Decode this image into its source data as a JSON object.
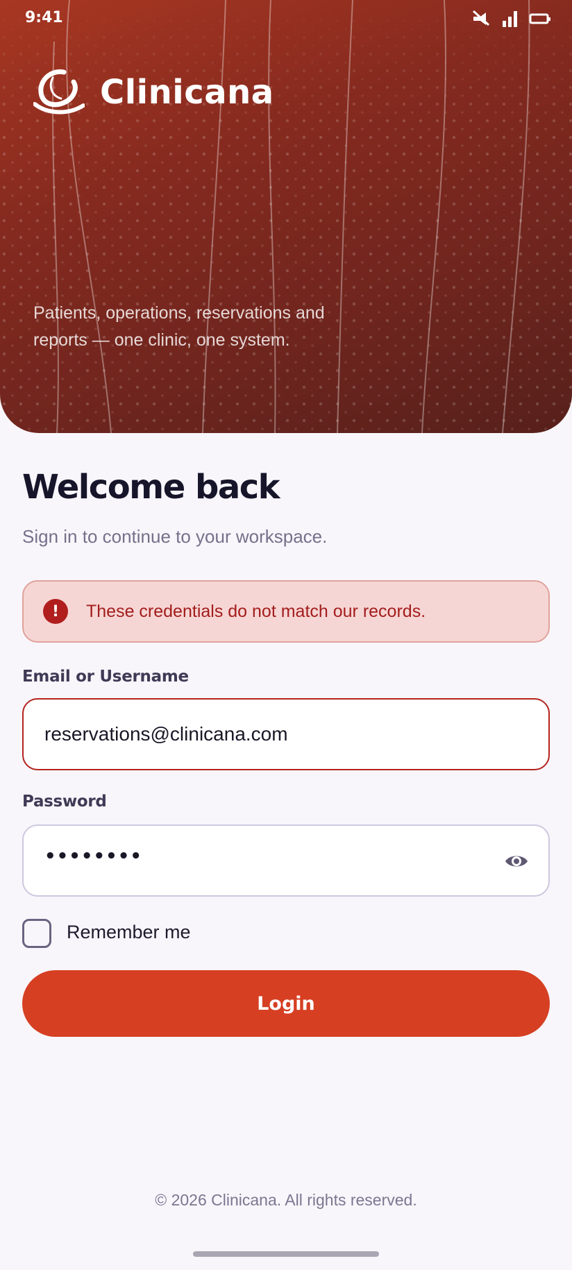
{
  "status_bar": {
    "time": "9:41",
    "icons": [
      "mute-icon",
      "signal-icon",
      "battery-icon"
    ]
  },
  "brand": {
    "name": "Clinicana",
    "logo": "clinicana-logo-icon"
  },
  "hero": {
    "tagline": "Patients, operations, reservations and reports — one clinic, one system."
  },
  "login": {
    "title": "Welcome back",
    "subtitle": "Sign in to continue to your workspace.",
    "error_message": "These credentials do not match our records.",
    "email_label": "Email or Username",
    "email_value": "reservations@clinicana.com",
    "password_label": "Password",
    "password_value": "••••••••",
    "remember_label": "Remember me",
    "remember_checked": false,
    "submit_label": "Login"
  },
  "footer": {
    "copyright": "© 2026 Clinicana. All rights reserved."
  },
  "colors": {
    "hero_gradient_start": "#a83722",
    "hero_gradient_end": "#57201b",
    "accent": "#d63f22",
    "error_text": "#a31d1d",
    "error_bg": "#f6d6d4",
    "page_bg": "#f8f6fb"
  }
}
